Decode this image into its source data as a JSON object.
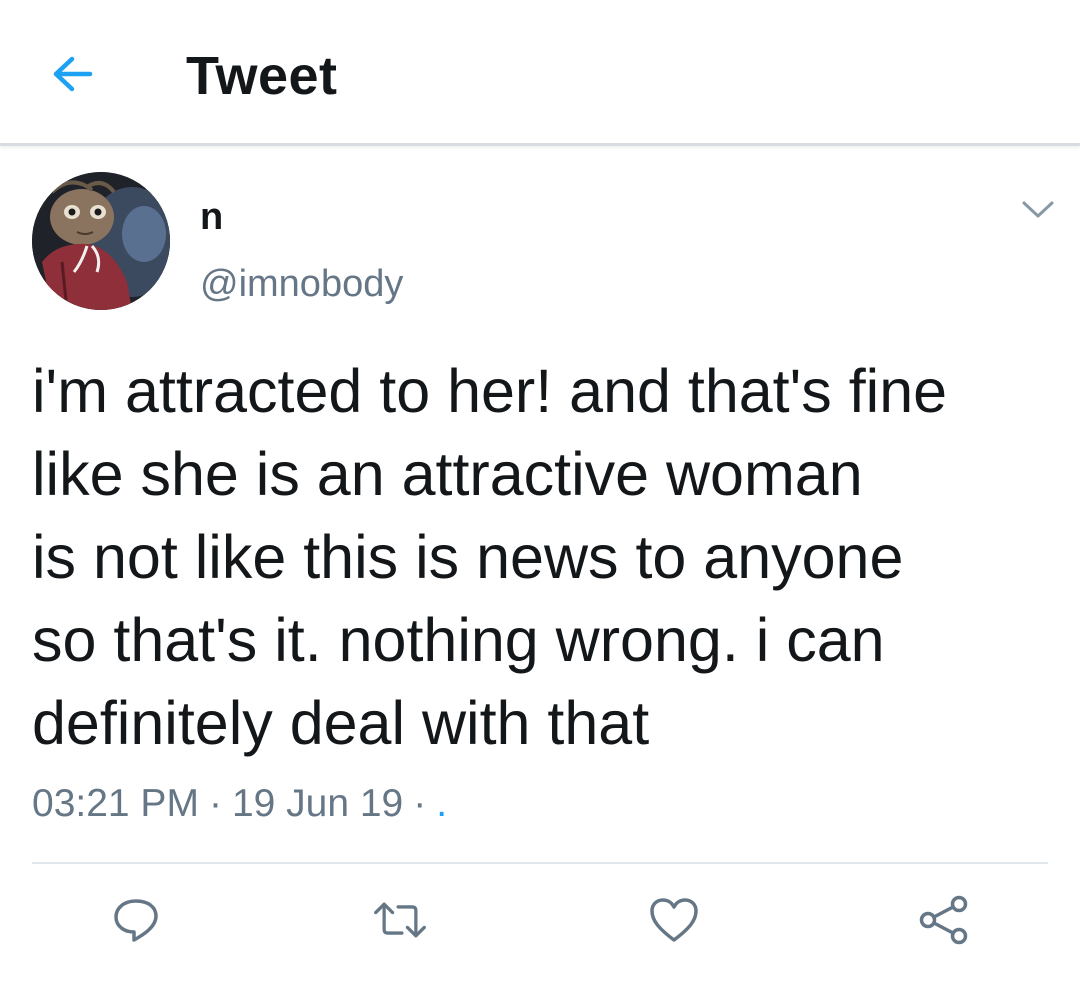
{
  "header": {
    "back_icon": "arrow-left-icon",
    "title": "Tweet",
    "accent_color": "#1da1f2"
  },
  "tweet": {
    "author": {
      "display_name": "n",
      "handle": "@imnobody",
      "avatar": "avatar-image"
    },
    "more_icon": "chevron-down-icon",
    "text": "i'm attracted to her! and that's fine\nlike she is an attractive woman\nis not like this is news to anyone\nso that's it. nothing wrong. i can\ndefinitely deal with that",
    "time": "03:21 PM",
    "date": "19 Jun 19",
    "source": "."
  },
  "actions": [
    {
      "icon": "reply-icon"
    },
    {
      "icon": "retweet-icon"
    },
    {
      "icon": "like-icon"
    },
    {
      "icon": "share-icon"
    }
  ],
  "colors": {
    "text": "#14171a",
    "secondary": "#657786",
    "link": "#1da1f2",
    "icon": "#657786"
  }
}
